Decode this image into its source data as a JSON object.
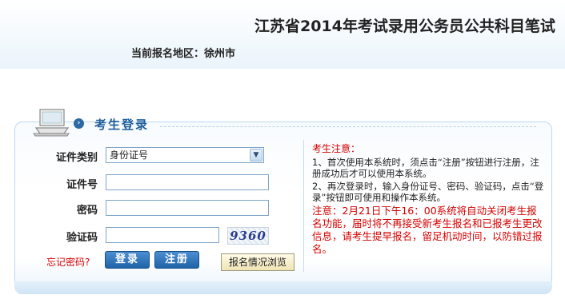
{
  "header": {
    "title": "江苏省2014年考试录用公务员公共科目笔试",
    "region_label": "当前报名地区：",
    "region_value": "徐州市"
  },
  "login": {
    "title": "考生登录",
    "id_type_label": "证件类别",
    "id_type_value": "身份证号",
    "id_number_label": "证件号",
    "id_number_value": "",
    "password_label": "密码",
    "password_value": "",
    "captcha_label": "验证码",
    "captcha_value": "",
    "captcha_image_text": "9360",
    "forgot_password": "忘记密码?",
    "login_button": "登录",
    "register_button": "注册",
    "browse_button": "报名情况浏览"
  },
  "notice": {
    "title": "考生注意：",
    "item1": "1、首次使用本系统时，须点击“注册”按钮进行注册，注册成功后才可以使用本系统。",
    "item2": "2、再次登录时，输入身份证号、密码、验证码，点击“登录”按钮即可使用和操作本系统。",
    "warning": "注意：2月21日下午16：00系统将自动关闭考生报名功能，届时将不再接受新考生报名和已报考生更改信息，请考生提早报名，留足机动时间，以防错过报名。"
  },
  "icons": {
    "laptop": "laptop-icon",
    "header_bullet": "arrow-circle-icon",
    "select_arrow": "chevron-down-icon"
  },
  "colors": {
    "accent": "#1f63a8",
    "title_blue": "#1f5e99",
    "warning_red": "#d40000"
  }
}
